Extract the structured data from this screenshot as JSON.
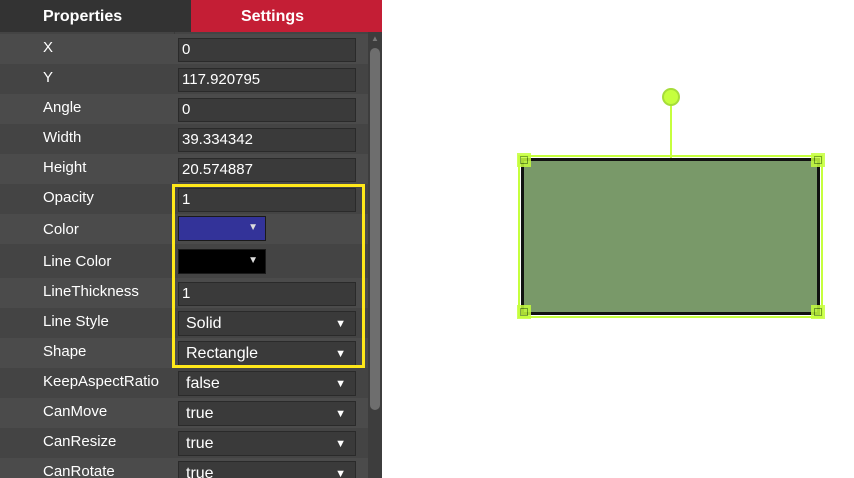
{
  "tabs": {
    "properties": "Properties",
    "settings": "Settings"
  },
  "properties": {
    "x": {
      "label": "X",
      "value": "0"
    },
    "y": {
      "label": "Y",
      "value": "117.920795"
    },
    "angle": {
      "label": "Angle",
      "value": "0"
    },
    "width": {
      "label": "Width",
      "value": "39.334342"
    },
    "height": {
      "label": "Height",
      "value": "20.574887"
    },
    "opacity": {
      "label": "Opacity",
      "value": "1"
    },
    "color": {
      "label": "Color",
      "swatch": "#333399"
    },
    "line_color": {
      "label": "Line Color",
      "swatch": "#000000"
    },
    "line_thickness": {
      "label": "LineThickness",
      "value": "1"
    },
    "line_style": {
      "label": "Line Style",
      "value": "Solid"
    },
    "shape": {
      "label": "Shape",
      "value": "Rectangle"
    },
    "keep_aspect_ratio": {
      "label": "KeepAspectRatio",
      "value": "false"
    },
    "can_move": {
      "label": "CanMove",
      "value": "true"
    },
    "can_resize": {
      "label": "CanResize",
      "value": "true"
    },
    "can_rotate": {
      "label": "CanRotate",
      "value": "true"
    }
  },
  "icons": {
    "dropdown": "caret-down-icon",
    "rotate": "rotate-handle-icon",
    "resize": "resize-handle-icon"
  },
  "colors": {
    "accent_tab": "#c41e35",
    "highlight_box": "#ffe81a",
    "shape_fill": "#799969",
    "shape_border": "#111111",
    "selection": "#c6ff3d"
  }
}
